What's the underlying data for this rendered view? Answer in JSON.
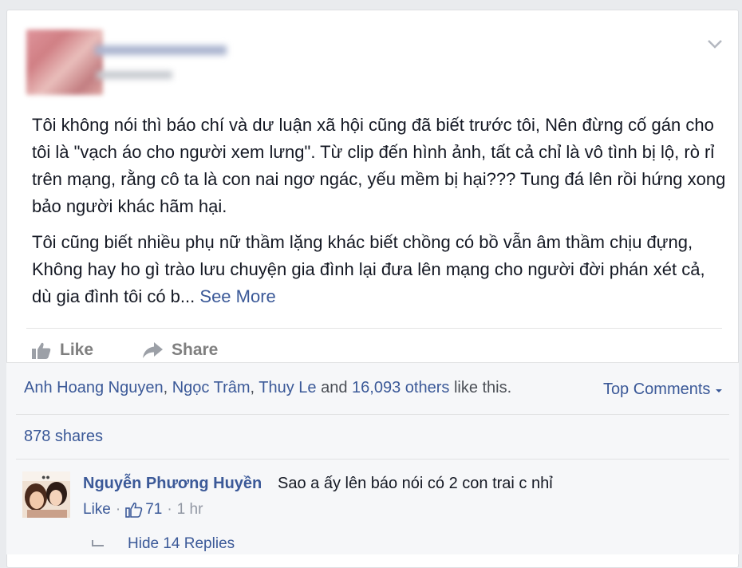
{
  "post": {
    "paragraphs": [
      "Tôi không nói thì báo chí và dư luận xã hội cũng đã biết trước tôi, Nên đừng cố gán cho tôi là \"vạch áo cho người xem lưng\". Từ clip đến hình ảnh, tất cả chỉ là vô tình bị lộ, rò rỉ trên mạng, rằng cô ta là con nai ngơ ngác, yếu mềm bị hại??? Tung đá lên rồi hứng xong bảo người khác hãm hại.",
      "Tôi cũng biết nhiều phụ nữ thầm lặng khác biết chồng có bồ vẫn âm thầm chịu đựng, Không hay ho gì trào lưu chuyện gia đình lại đưa lên mạng cho người đời phán xét cả, dù gia đình tôi có b..."
    ],
    "see_more": "See More"
  },
  "actions": {
    "like": "Like",
    "share": "Share"
  },
  "ufi": {
    "liker1": "Anh Hoang Nguyen",
    "liker2": "Ngọc Trâm",
    "liker3": "Thuy Le",
    "and": "and",
    "others": "16,093 others",
    "like_this": "like this.",
    "top_comments": "Top Comments",
    "shares": "878 shares"
  },
  "comment": {
    "author": "Nguyễn Phương Huyền",
    "text": "Sao a ấy lên báo nói có 2 con trai c nhỉ",
    "like": "Like",
    "likes_count": "71",
    "time": "1 hr",
    "hide_replies": "Hide 14 Replies"
  },
  "colors": {
    "link": "#3b5998",
    "muted": "#9197a3",
    "background": "#e9ebee"
  }
}
